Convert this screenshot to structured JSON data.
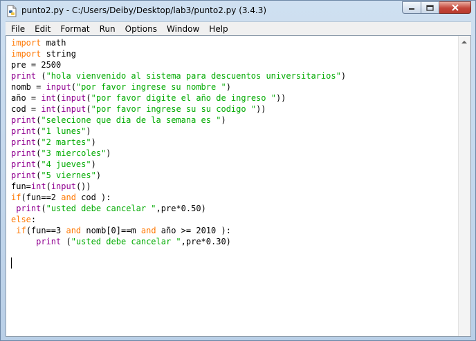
{
  "window": {
    "title": "punto2.py - C:/Users/Deiby/Desktop/lab3/punto2.py (3.4.3)",
    "icons": {
      "app": "python-file-icon",
      "minimize": "minimize-icon",
      "maximize": "maximize-icon",
      "close": "close-icon"
    }
  },
  "menu": [
    "File",
    "Edit",
    "Format",
    "Run",
    "Options",
    "Window",
    "Help"
  ],
  "editor": {
    "colors": {
      "keyword": "#ff7700",
      "builtin": "#900090",
      "string": "#00aa00",
      "text": "#000000"
    },
    "lines": [
      [
        {
          "t": "import",
          "c": "kw"
        },
        {
          "t": " math",
          "c": ""
        }
      ],
      [
        {
          "t": "import",
          "c": "kw"
        },
        {
          "t": " string",
          "c": ""
        }
      ],
      [
        {
          "t": "pre = 2500",
          "c": ""
        }
      ],
      [
        {
          "t": "print",
          "c": "bi"
        },
        {
          "t": " (",
          "c": ""
        },
        {
          "t": "\"hola vienvenido al sistema para descuentos universitarios\"",
          "c": "st"
        },
        {
          "t": ")",
          "c": ""
        }
      ],
      [
        {
          "t": "nomb = ",
          "c": ""
        },
        {
          "t": "input",
          "c": "bi"
        },
        {
          "t": "(",
          "c": ""
        },
        {
          "t": "\"por favor ingrese su nombre \"",
          "c": "st"
        },
        {
          "t": ")",
          "c": ""
        }
      ],
      [
        {
          "t": "año = ",
          "c": ""
        },
        {
          "t": "int",
          "c": "bi"
        },
        {
          "t": "(",
          "c": ""
        },
        {
          "t": "input",
          "c": "bi"
        },
        {
          "t": "(",
          "c": ""
        },
        {
          "t": "\"por favor digite el año de ingreso \"",
          "c": "st"
        },
        {
          "t": "))",
          "c": ""
        }
      ],
      [
        {
          "t": "cod = ",
          "c": ""
        },
        {
          "t": "int",
          "c": "bi"
        },
        {
          "t": "(",
          "c": ""
        },
        {
          "t": "input",
          "c": "bi"
        },
        {
          "t": "(",
          "c": ""
        },
        {
          "t": "\"por favor ingrese su su codigo \"",
          "c": "st"
        },
        {
          "t": "))",
          "c": ""
        }
      ],
      [
        {
          "t": "print",
          "c": "bi"
        },
        {
          "t": "(",
          "c": ""
        },
        {
          "t": "\"selecione que dia de la semana es \"",
          "c": "st"
        },
        {
          "t": ")",
          "c": ""
        }
      ],
      [
        {
          "t": "print",
          "c": "bi"
        },
        {
          "t": "(",
          "c": ""
        },
        {
          "t": "\"1 lunes\"",
          "c": "st"
        },
        {
          "t": ")",
          "c": ""
        }
      ],
      [
        {
          "t": "print",
          "c": "bi"
        },
        {
          "t": "(",
          "c": ""
        },
        {
          "t": "\"2 martes\"",
          "c": "st"
        },
        {
          "t": ")",
          "c": ""
        }
      ],
      [
        {
          "t": "print",
          "c": "bi"
        },
        {
          "t": "(",
          "c": ""
        },
        {
          "t": "\"3 miercoles\"",
          "c": "st"
        },
        {
          "t": ")",
          "c": ""
        }
      ],
      [
        {
          "t": "print",
          "c": "bi"
        },
        {
          "t": "(",
          "c": ""
        },
        {
          "t": "\"4 jueves\"",
          "c": "st"
        },
        {
          "t": ")",
          "c": ""
        }
      ],
      [
        {
          "t": "print",
          "c": "bi"
        },
        {
          "t": "(",
          "c": ""
        },
        {
          "t": "\"5 viernes\"",
          "c": "st"
        },
        {
          "t": ")",
          "c": ""
        }
      ],
      [
        {
          "t": "fun=",
          "c": ""
        },
        {
          "t": "int",
          "c": "bi"
        },
        {
          "t": "(",
          "c": ""
        },
        {
          "t": "input",
          "c": "bi"
        },
        {
          "t": "())",
          "c": ""
        }
      ],
      [
        {
          "t": "if",
          "c": "kw"
        },
        {
          "t": "(fun==2 ",
          "c": ""
        },
        {
          "t": "and",
          "c": "kw"
        },
        {
          "t": " cod ):",
          "c": ""
        }
      ],
      [
        {
          "t": " ",
          "c": ""
        },
        {
          "t": "print",
          "c": "bi"
        },
        {
          "t": "(",
          "c": ""
        },
        {
          "t": "\"usted debe cancelar \"",
          "c": "st"
        },
        {
          "t": ",pre*0.50)",
          "c": ""
        }
      ],
      [
        {
          "t": "else",
          "c": "kw"
        },
        {
          "t": ":",
          "c": ""
        }
      ],
      [
        {
          "t": " ",
          "c": ""
        },
        {
          "t": "if",
          "c": "kw"
        },
        {
          "t": "(fun==3 ",
          "c": ""
        },
        {
          "t": "and",
          "c": "kw"
        },
        {
          "t": " nomb[0]==m ",
          "c": ""
        },
        {
          "t": "and",
          "c": "kw"
        },
        {
          "t": " año >= 2010 ):",
          "c": ""
        }
      ],
      [
        {
          "t": "     ",
          "c": ""
        },
        {
          "t": "print",
          "c": "bi"
        },
        {
          "t": " (",
          "c": ""
        },
        {
          "t": "\"usted debe cancelar \"",
          "c": "st"
        },
        {
          "t": ",pre*0.30)",
          "c": ""
        }
      ],
      [
        {
          "t": "",
          "c": ""
        }
      ]
    ]
  }
}
